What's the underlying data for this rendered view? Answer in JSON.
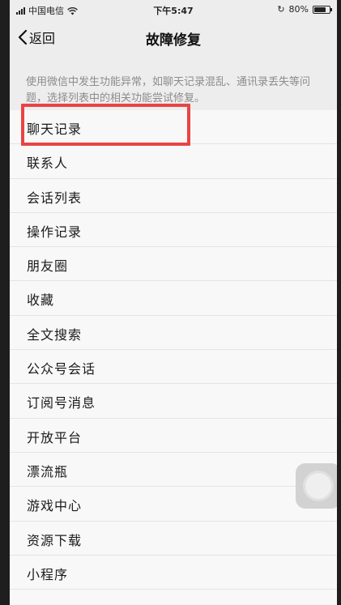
{
  "status_bar": {
    "carrier": "中国电信",
    "time": "下午5:47",
    "battery_percent": "80%",
    "battery_level": 0.8
  },
  "nav": {
    "back_label": "返回",
    "title": "故障修复"
  },
  "description": "使用微信中发生功能异常，如聊天记录混乱、通讯录丢失等问题，选择列表中的相关功能尝试修复。",
  "list": {
    "items": [
      "聊天记录",
      "联系人",
      "会话列表",
      "操作记录",
      "朋友圈",
      "收藏",
      "全文搜索",
      "公众号会话",
      "订阅号消息",
      "开放平台",
      "漂流瓶",
      "游戏中心",
      "资源下载",
      "小程序"
    ],
    "highlighted_index": 0
  },
  "colors": {
    "highlight": "#e64545",
    "background": "#ededed",
    "list_background": "#f8f8f8"
  }
}
